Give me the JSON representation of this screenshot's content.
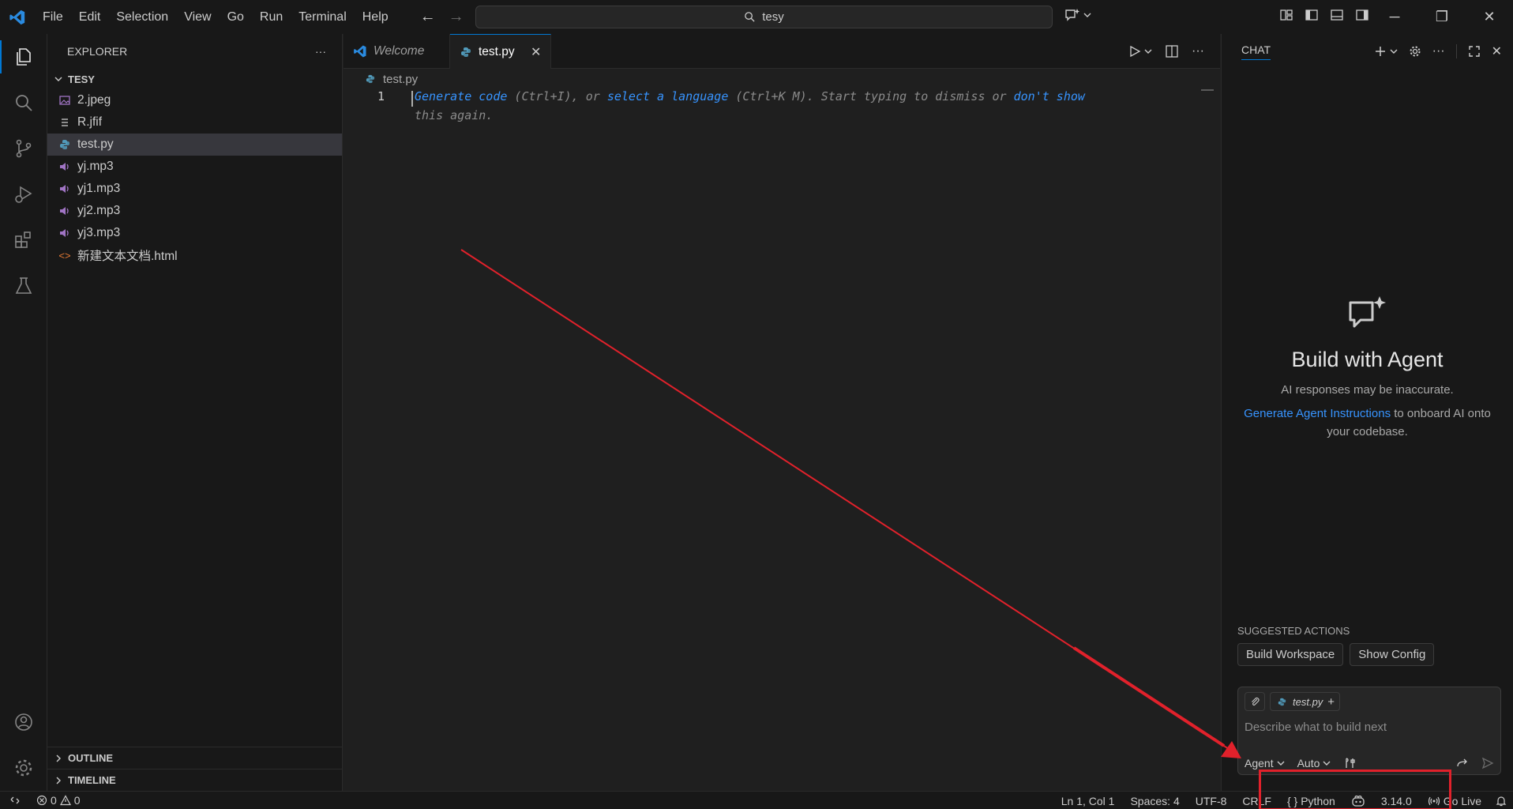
{
  "titlebar": {
    "menu": [
      "File",
      "Edit",
      "Selection",
      "View",
      "Go",
      "Run",
      "Terminal",
      "Help"
    ],
    "search_text": "tesy"
  },
  "explorer": {
    "header": "EXPLORER",
    "folder": "TESY",
    "files": [
      {
        "name": "2.jpeg",
        "icon": "image-icon",
        "selected": false
      },
      {
        "name": "R.jfif",
        "icon": "file-lines-icon",
        "selected": false
      },
      {
        "name": "test.py",
        "icon": "python-icon",
        "selected": true
      },
      {
        "name": "yj.mp3",
        "icon": "audio-icon",
        "selected": false
      },
      {
        "name": "yj1.mp3",
        "icon": "audio-icon",
        "selected": false
      },
      {
        "name": "yj2.mp3",
        "icon": "audio-icon",
        "selected": false
      },
      {
        "name": "yj3.mp3",
        "icon": "audio-icon",
        "selected": false
      },
      {
        "name": "新建文本文档.html",
        "icon": "html-icon",
        "selected": false
      }
    ],
    "outline": "OUTLINE",
    "timeline": "TIMELINE"
  },
  "editor": {
    "tabs": [
      {
        "label": "Welcome",
        "active": false
      },
      {
        "label": "test.py",
        "active": true
      }
    ],
    "breadcrumb": "test.py",
    "line_number": "1",
    "hint": {
      "link1": "Generate code",
      "text1": " (Ctrl+I), or ",
      "link2": "select a language",
      "text2": " (Ctrl+K M). Start typing to dismiss or ",
      "link3": "don't show",
      "line2": "this again."
    }
  },
  "chat": {
    "title": "CHAT",
    "heading": "Build with Agent",
    "subtitle": "AI responses may be inaccurate.",
    "link": "Generate Agent Instructions",
    "link_suffix": " to onboard AI onto your codebase.",
    "suggested_title": "SUGGESTED ACTIONS",
    "suggested": [
      "Build Workspace",
      "Show Config"
    ],
    "context_chip": "test.py",
    "placeholder": "Describe what to build next",
    "mode": "Agent",
    "model": "Auto"
  },
  "statusbar": {
    "errors": "0",
    "warnings": "0",
    "position": "Ln 1, Col 1",
    "spaces": "Spaces: 4",
    "encoding": "UTF-8",
    "eol": "CRLF",
    "language": "Python",
    "version": "3.14.0",
    "golive": "Go Live"
  },
  "colors": {
    "accent": "#0078d4",
    "link": "#3794ff",
    "annotation": "#e1212b"
  }
}
